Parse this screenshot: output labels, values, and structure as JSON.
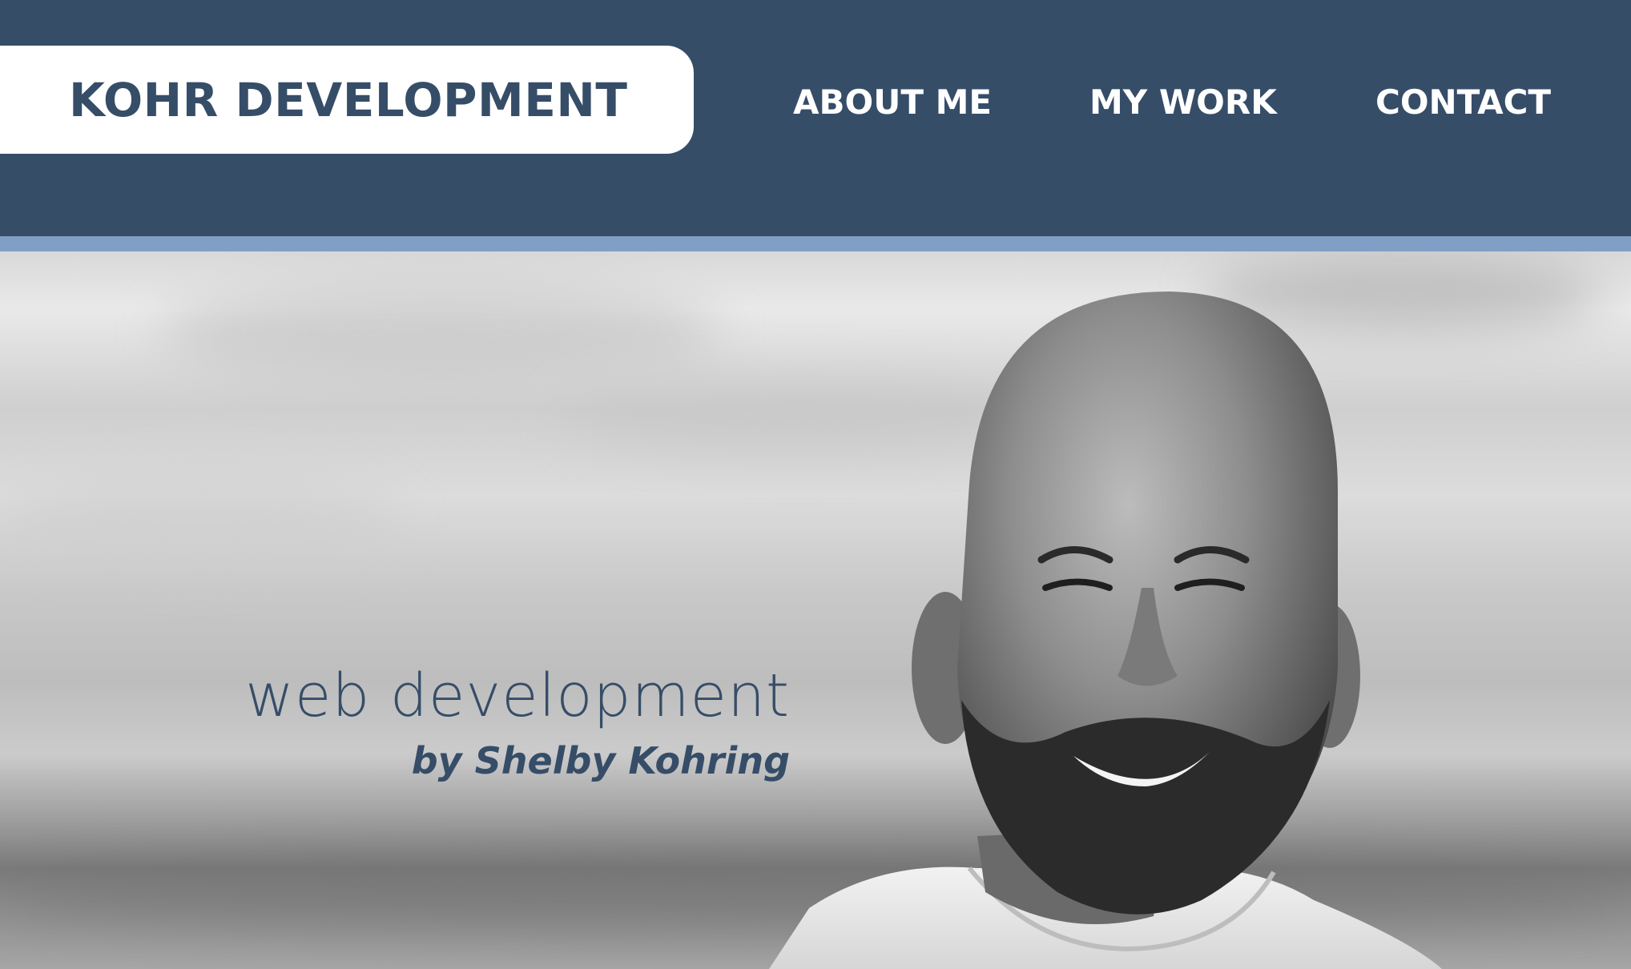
{
  "header": {
    "logo_text": "KOHR DEVELOPMENT",
    "nav": [
      {
        "label": "ABOUT ME"
      },
      {
        "label": "MY WORK"
      },
      {
        "label": "CONTACT"
      }
    ]
  },
  "hero": {
    "headline": "web development",
    "byline": "by Shelby Kohring",
    "image": "portrait-photo"
  },
  "colors": {
    "header_bg": "#364d68",
    "accent_stripe": "#7f9fc6",
    "logo_bg": "#ffffff",
    "text_dark": "#364d68",
    "nav_text": "#ffffff"
  }
}
